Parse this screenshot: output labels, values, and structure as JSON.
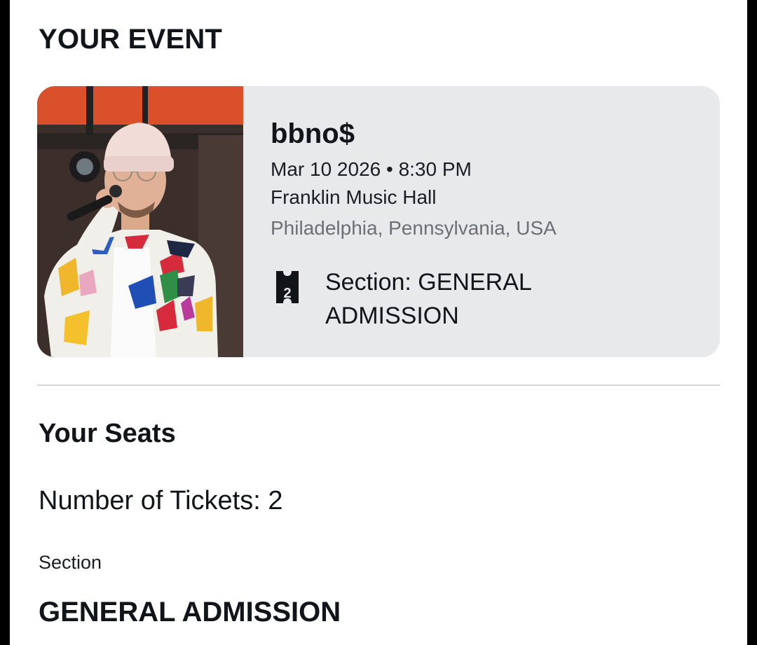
{
  "header": {
    "title": "YOUR EVENT"
  },
  "event": {
    "artist": "bbno$",
    "datetime": "Mar 10 2026 • 8:30 PM",
    "venue": "Franklin Music Hall",
    "location": "Philadelphia, Pennsylvania, USA",
    "section_line1": "Section: GENERAL",
    "section_line2": "ADMISSION",
    "ticket_icon": "ticket-icon",
    "ticket_icon_number": "2"
  },
  "seats": {
    "title": "Your Seats",
    "tickets_label": "Number of Tickets: 2",
    "section_label": "Section",
    "section_value": "GENERAL ADMISSION"
  },
  "colors": {
    "card_background": "#e7e9eb",
    "muted_text": "#6b7075",
    "divider": "#d4d6d9"
  }
}
